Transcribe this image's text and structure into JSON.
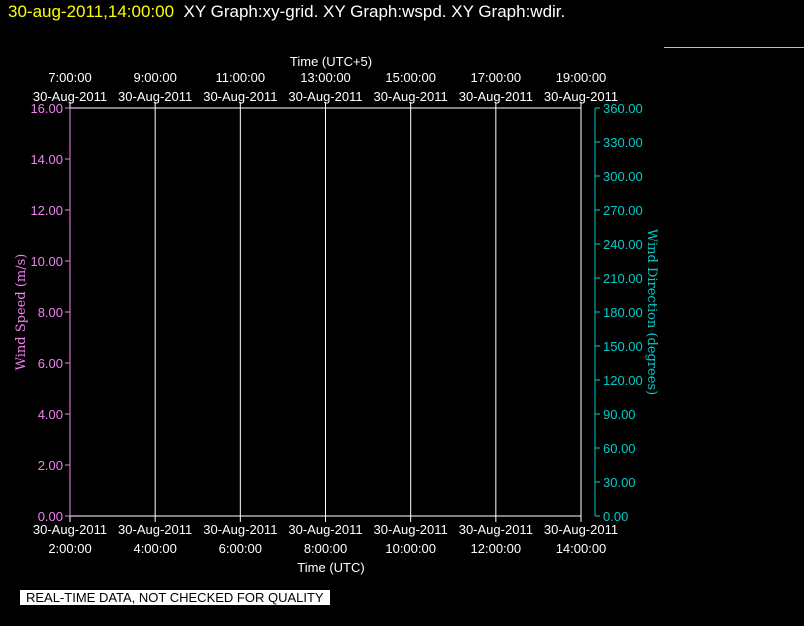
{
  "header": {
    "timestamp": "30-aug-2011,14:00:00",
    "graphs": "XY Graph:xy-grid.  XY Graph:wspd.  XY Graph:wdir."
  },
  "quality_notice": "REAL-TIME DATA, NOT CHECKED FOR QUALITY",
  "colors": {
    "timestamp": "#ffff00",
    "left_axis": "#ee82ee",
    "right_axis": "#00cccc",
    "grid": "#ffffff",
    "text": "#ffffff"
  },
  "chart_data": {
    "type": "line",
    "x_top_label": "Time (UTC+5)",
    "x_bottom_label": "Time (UTC)",
    "x_ticks_top": [
      {
        "time": "7:00:00",
        "date": "30-Aug-2011"
      },
      {
        "time": "9:00:00",
        "date": "30-Aug-2011"
      },
      {
        "time": "11:00:00",
        "date": "30-Aug-2011"
      },
      {
        "time": "13:00:00",
        "date": "30-Aug-2011"
      },
      {
        "time": "15:00:00",
        "date": "30-Aug-2011"
      },
      {
        "time": "17:00:00",
        "date": "30-Aug-2011"
      },
      {
        "time": "19:00:00",
        "date": "30-Aug-2011"
      }
    ],
    "x_ticks_bottom": [
      {
        "time": "2:00:00",
        "date": "30-Aug-2011"
      },
      {
        "time": "4:00:00",
        "date": "30-Aug-2011"
      },
      {
        "time": "6:00:00",
        "date": "30-Aug-2011"
      },
      {
        "time": "8:00:00",
        "date": "30-Aug-2011"
      },
      {
        "time": "10:00:00",
        "date": "30-Aug-2011"
      },
      {
        "time": "12:00:00",
        "date": "30-Aug-2011"
      },
      {
        "time": "14:00:00",
        "date": "30-Aug-2011"
      }
    ],
    "y_left_label": "Wind Speed (m/s)",
    "y_left_ticks": [
      "0.00",
      "2.00",
      "4.00",
      "6.00",
      "8.00",
      "10.00",
      "12.00",
      "14.00",
      "16.00"
    ],
    "y_right_label": "Wind Direction (degrees)",
    "y_right_ticks": [
      "0.00",
      "30.00",
      "60.00",
      "90.00",
      "120.00",
      "150.00",
      "180.00",
      "210.00",
      "240.00",
      "270.00",
      "300.00",
      "330.00",
      "360.00"
    ],
    "ylim_left": [
      0,
      16
    ],
    "ylim_right": [
      0,
      360
    ],
    "grid": true,
    "series": []
  }
}
